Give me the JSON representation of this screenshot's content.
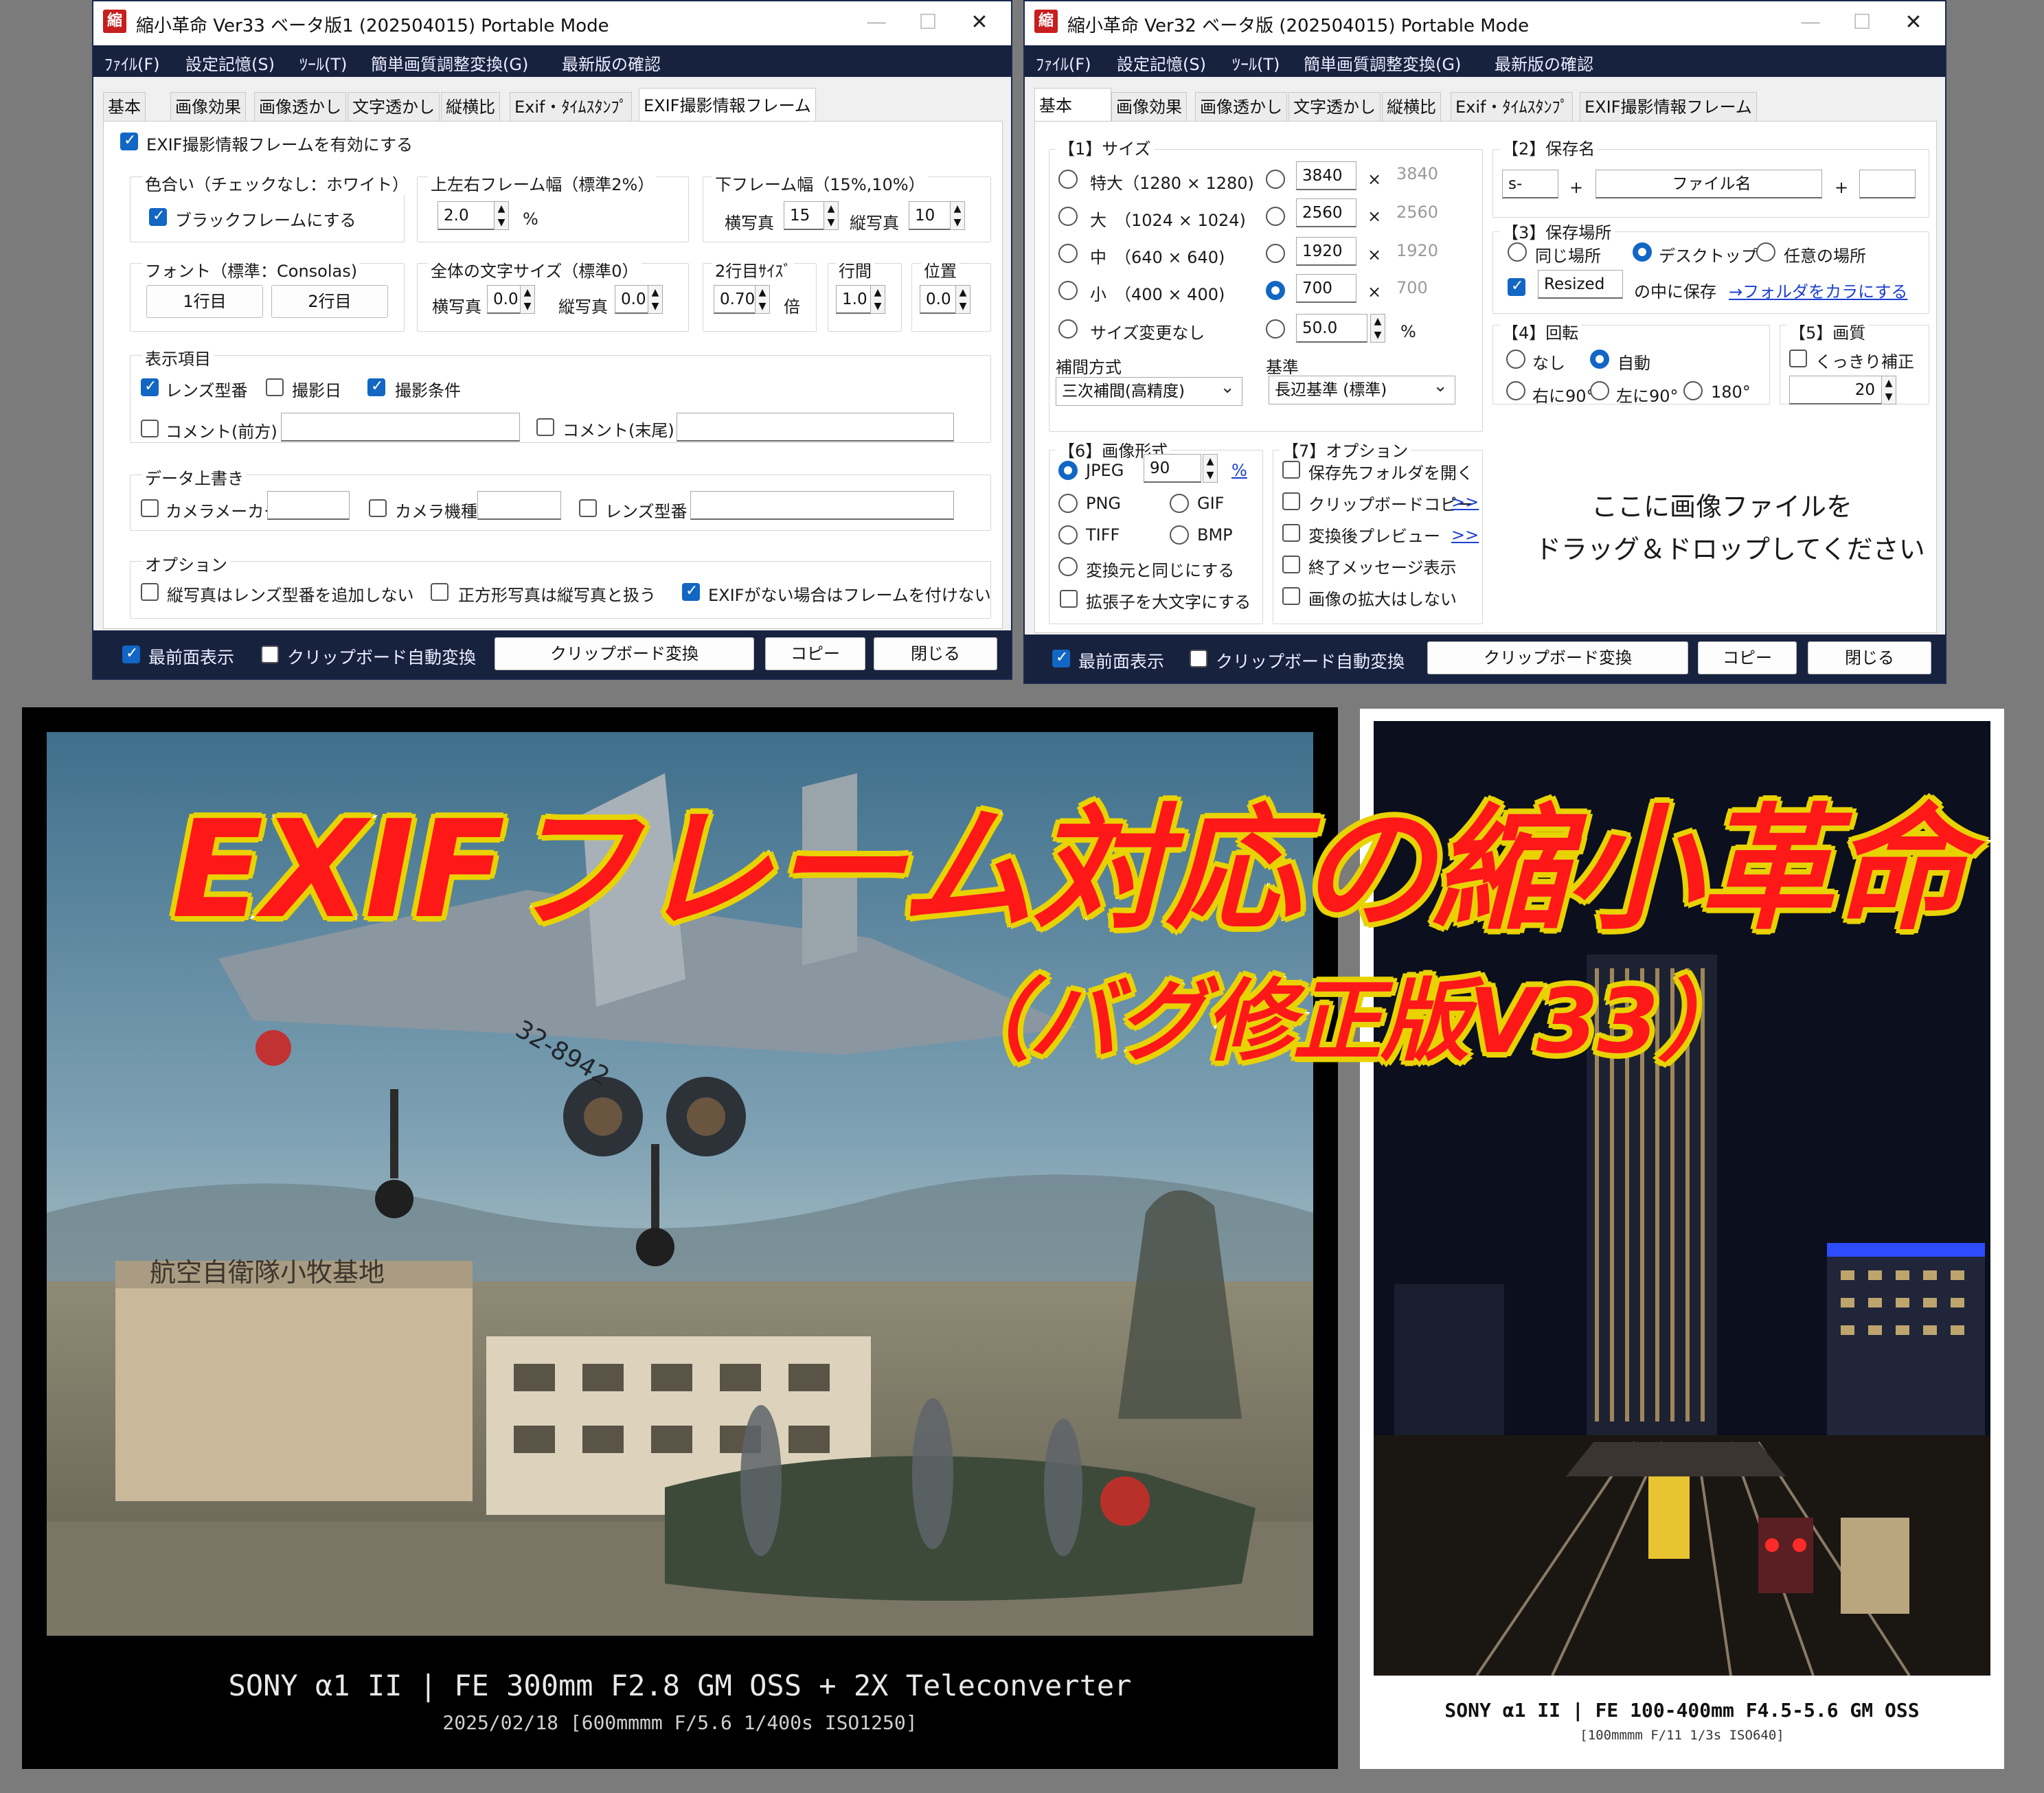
{
  "left_window": {
    "title": "縮小革命 Ver33 ベータ版1 (202504015)    Portable Mode",
    "app_icon": "縮",
    "menu": [
      "ﾌｧｲﾙ(F)",
      "設定記憶(S)",
      "ﾂｰﾙ(T)",
      "簡単画質調整変換(G)",
      "最新版の確認"
    ],
    "tabs": [
      "基本",
      "画像効果",
      "画像透かし",
      "文字透かし",
      "縦横比",
      "Exif・ﾀｲﾑｽﾀﾝﾌﾟ",
      "EXIF撮影情報フレーム"
    ],
    "active_tab": "EXIF撮影情報フレーム",
    "enable_frame": "EXIF撮影情報フレームを有効にする",
    "color_group": "色合い（チェックなし：ホワイト）",
    "black_frame": "ブラックフレームにする",
    "tlr_group": "上左右フレーム幅（標準2%）",
    "tlr_value": "2.0",
    "percent": "%",
    "bottom_group": "下フレーム幅（15%,10%）",
    "landscape": "横写真",
    "portrait": "縦写真",
    "bottom_land": "15",
    "bottom_port": "10",
    "font_group": "フォント（標準：Consolas)",
    "line1_btn": "1行目",
    "line2_btn": "2行目",
    "textsize_group": "全体の文字サイズ（標準0）",
    "textsize_land": "0.0",
    "textsize_port": "0.0",
    "line2size_group": "2行目ｻｲｽﾞ",
    "line2size": "0.70",
    "times": "倍",
    "linespace_group": "行間",
    "linespace": "1.0",
    "position_group": "位置",
    "position": "0.0",
    "display_group": "表示項目",
    "lens_model": "レンズ型番",
    "shot_date": "撮影日",
    "shot_cond": "撮影条件",
    "comment_pre": "コメント(前方)",
    "comment_post": "コメント(末尾)",
    "override_group": "データ上書き",
    "maker": "カメラメーカー",
    "model": "カメラ機種",
    "lens": "レンズ型番",
    "option_group": "オプション",
    "opt1": "縦写真はレンズ型番を追加しない",
    "opt2": "正方形写真は縦写真と扱う",
    "opt3": "EXIFがない場合はフレームを付けない",
    "topmost": "最前面表示",
    "clip_auto": "クリップボード自動変換",
    "clip_convert": "クリップボード変換",
    "copy": "コピー",
    "close": "閉じる"
  },
  "right_window": {
    "title": "縮小革命 Ver32 ベータ版 (202504015)    Portable Mode",
    "app_icon": "縮",
    "menu": [
      "ﾌｧｲﾙ(F)",
      "設定記憶(S)",
      "ﾂｰﾙ(T)",
      "簡単画質調整変換(G)",
      "最新版の確認"
    ],
    "tabs": [
      "基本",
      "画像効果",
      "画像透かし",
      "文字透かし",
      "縦横比",
      "Exif・ﾀｲﾑｽﾀﾝﾌﾟ",
      "EXIF撮影情報フレーム"
    ],
    "active_tab": "基本",
    "size_group": "【1】サイズ",
    "sizes": [
      "特大（1280 × 1280)",
      "大　（1024 × 1024)",
      "中　（640 × 640)",
      "小　（400 × 400)",
      "サイズ変更なし"
    ],
    "custom_w": [
      "3840",
      "2560",
      "1920",
      "700"
    ],
    "custom_h": [
      "3840",
      "2560",
      "1920",
      "700"
    ],
    "mult": "×",
    "percent_val": "50.0",
    "percent": "%",
    "interp_label": "補間方式",
    "interp_value": "三次補間(高精度)",
    "basis_label": "基準",
    "basis_value": "長辺基準 (標準)",
    "savename_group": "【2】保存名",
    "prefix": "s-",
    "plus": "+",
    "filename": "ファイル名",
    "suffix": "",
    "saveloc_group": "【3】保存場所",
    "loc_same": "同じ場所",
    "loc_desktop": "デスクトップ",
    "loc_any": "任意の場所",
    "subfolder": "Resized",
    "subfolder_suffix": "の中に保存",
    "subfolder_link": "→フォルダをカラにする",
    "rotate_group": "【4】回転",
    "rot_none": "なし",
    "rot_auto": "自動",
    "rot_right": "右に90°",
    "rot_left": "左に90°",
    "rot_180": "180°",
    "quality_group": "【5】画質",
    "sharpen": "くっきり補正",
    "quality_val": "20",
    "format_group": "【6】画像形式",
    "jpeg": "JPEG",
    "jpeg_q": "90",
    "png": "PNG",
    "gif": "GIF",
    "tiff": "TIFF",
    "bmp": "BMP",
    "same_as_src": "変換元と同じにする",
    "upper_ext": "拡張子を大文字にする",
    "option_group": "【7】オプション",
    "opt_open": "保存先フォルダを開く",
    "opt_clip": "クリップボードコピー",
    "opt_preview": "変換後プレビュー",
    "opt_endmsg": "終了メッセージ表示",
    "opt_noenlarge": "画像の拡大はしない",
    "more": ">>",
    "drop1": "ここに画像ファイルを",
    "drop2": "ドラッグ＆ドロップしてください",
    "topmost": "最前面表示",
    "clip_auto": "クリップボード自動変換",
    "clip_convert": "クリップボード変換",
    "copy": "コピー",
    "close": "閉じる"
  },
  "banner": {
    "line1": "EXIFフレーム対応の縮小革命",
    "line2": "（バグ修正版V33）"
  },
  "photo_left": {
    "caption1": "SONY α1 II | FE 300mm F2.8 GM OSS + 2X Teleconverter",
    "caption2": "2025/02/18 [600mmmm F/5.6 1/400s ISO1250]",
    "tail_text": "32-8942",
    "building_text": "航空自衛隊小牧基地"
  },
  "photo_right": {
    "caption1": "SONY α1 II | FE 100-400mm F4.5-5.6 GM OSS",
    "caption2": "[100mmmm F/11 1/3s ISO640]"
  },
  "colors": {
    "menubar": "#17223f",
    "accent": "#1266c4",
    "banner_red": "#ff1818",
    "banner_yellow": "#e8d300"
  }
}
